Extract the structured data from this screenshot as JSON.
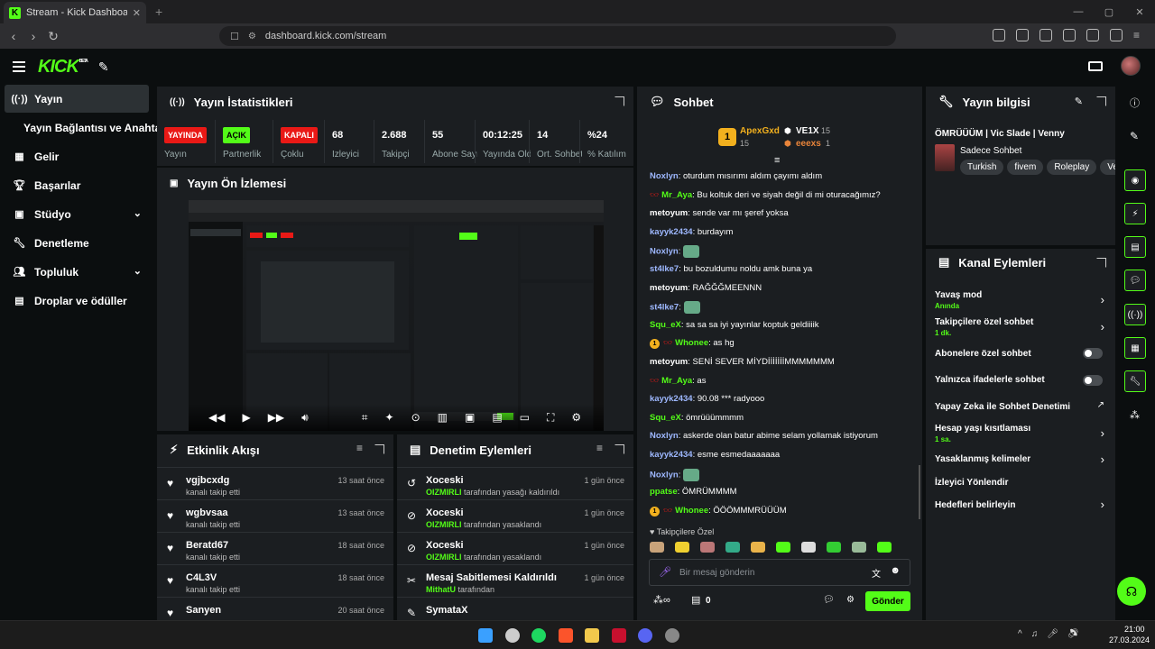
{
  "browser": {
    "tab_title": "Stream - Kick Dashboard",
    "url": "dashboard.kick.com/stream"
  },
  "header": {
    "logo": "KICK",
    "logo_badge": "BETA"
  },
  "sidebar": {
    "items": [
      {
        "label": "Yayın",
        "icon": "broadcast-icon"
      },
      {
        "label": "Yayın Bağlantısı ve Anahtarı",
        "icon": ""
      },
      {
        "label": "Gelir",
        "icon": "dollar-icon"
      },
      {
        "label": "Başarılar",
        "icon": "trophy-icon"
      },
      {
        "label": "Stüdyo",
        "icon": "studio-icon"
      },
      {
        "label": "Denetleme",
        "icon": "wrench-icon"
      },
      {
        "label": "Topluluk",
        "icon": "community-icon"
      },
      {
        "label": "Droplar ve ödüller",
        "icon": "gift-icon"
      }
    ]
  },
  "stats": {
    "title": "Yayın İstatistikleri",
    "cells": [
      {
        "badge": "YAYINDA",
        "label": "Yayın",
        "color": "#e91916"
      },
      {
        "badge": "AÇIK",
        "label": "Partnerlik",
        "color": "#53fc18"
      },
      {
        "badge": "KAPALI",
        "label": "Çoklu",
        "color": "#e91916"
      },
      {
        "value": "68",
        "label": "İzleyici"
      },
      {
        "value": "2.688",
        "label": "Takipçi"
      },
      {
        "value": "55",
        "label": "Abone Sayısı"
      },
      {
        "value": "00:12:25",
        "label": "Yayında Olduğu Süre"
      },
      {
        "value": "14",
        "label": "Ort. Sohbet"
      },
      {
        "value": "%24",
        "label": "% Katılım"
      }
    ]
  },
  "preview": {
    "title": "Yayın Ön İzlemesi"
  },
  "activity": {
    "title": "Etkinlik Akışı",
    "rows": [
      {
        "name": "vgjbcxdg",
        "sub": "kanalı takip etti",
        "time": "13 saat önce"
      },
      {
        "name": "wgbvsaa",
        "sub": "kanalı takip etti",
        "time": "13 saat önce"
      },
      {
        "name": "Beratd67",
        "sub": "kanalı takip etti",
        "time": "18 saat önce"
      },
      {
        "name": "C4L3V",
        "sub": "kanalı takip etti",
        "time": "18 saat önce"
      },
      {
        "name": "Sanyen",
        "sub": "",
        "time": "20 saat önce"
      }
    ]
  },
  "moderation": {
    "title": "Denetim Eylemleri",
    "rows": [
      {
        "name": "Xoceski",
        "by": "OIZMIRLI",
        "sub": "tarafından yasağı kaldırıldı",
        "time": "1 gün önce",
        "icon": "undo-icon"
      },
      {
        "name": "Xoceski",
        "by": "OIZMIRLI",
        "sub": "tarafından yasaklandı",
        "time": "1 gün önce",
        "icon": "ban-icon"
      },
      {
        "name": "Xoceski",
        "by": "OIZMIRLI",
        "sub": "tarafından yasaklandı",
        "time": "1 gün önce",
        "icon": "ban-icon"
      },
      {
        "name": "Mesaj Sabitlemesi Kaldırıldı",
        "by": "MithatU",
        "sub": "tarafından",
        "time": "1 gün önce",
        "icon": "unpin-icon"
      },
      {
        "name": "SymataX",
        "by": "",
        "sub": "",
        "time": "",
        "icon": "pin-icon"
      }
    ]
  },
  "chat": {
    "title": "Sohbet",
    "top": [
      {
        "rank": "1",
        "name": "ApexGxd",
        "count": "15"
      },
      {
        "name": "VE1X",
        "count": "15"
      },
      {
        "name": "eeexs",
        "count": "1"
      }
    ],
    "messages": [
      {
        "user": "Noxlyn",
        "text": "oturdum mısırımı aldım çayımı aldım",
        "color": "#9eb8ff"
      },
      {
        "user": "Mr_Aya",
        "text": "Bu koltuk deri ve siyah değil di mi oturacağımız?",
        "color": "#53fc18"
      },
      {
        "user": "metoyum",
        "text": "sende var mı şeref yoksa",
        "color": "#ffffff"
      },
      {
        "user": "kayyk2434",
        "text": "burdayım",
        "color": "#9eb8ff"
      },
      {
        "user": "Noxlyn",
        "text": "",
        "color": "#9eb8ff"
      },
      {
        "user": "st4lke7",
        "text": "bu bozuldumu noldu amk buna ya",
        "color": "#9eb8ff"
      },
      {
        "user": "metoyum",
        "text": "RAĞĞĞMEENNN",
        "color": "#ffffff"
      },
      {
        "user": "st4lke7",
        "text": "",
        "color": "#9eb8ff"
      },
      {
        "user": "Squ_eX",
        "text": "sa sa sa iyi yayınlar koptuk geldiiiik",
        "color": "#53fc18"
      },
      {
        "user": "Whonee",
        "text": "as hg",
        "color": "#53fc18"
      },
      {
        "user": "metoyum",
        "text": "SENİ SEVER MİYDİİİİİİİMMMMMMM",
        "color": "#ffffff"
      },
      {
        "user": "Mr_Aya",
        "text": "as",
        "color": "#53fc18"
      },
      {
        "user": "kayyk2434",
        "text": "90.08 *** radyooo",
        "color": "#9eb8ff"
      },
      {
        "user": "Squ_eX",
        "text": "ömrüüümmmm",
        "color": "#53fc18"
      },
      {
        "user": "Noxlyn",
        "text": "askerde olan batur abime selam yollamak istiyorum",
        "color": "#9eb8ff"
      },
      {
        "user": "kayyk2434",
        "text": "esme esmedaaaaaaa",
        "color": "#9eb8ff"
      },
      {
        "user": "Noxlyn",
        "text": "",
        "color": "#9eb8ff"
      },
      {
        "user": "ppatse",
        "text": "ÖMRÜMMMM",
        "color": "#53fc18"
      },
      {
        "user": "Whonee",
        "text": "ÖÖÖMMMRÜÜÜM",
        "color": "#53fc18"
      }
    ],
    "followers_only": "Takipçilere Özel",
    "placeholder": "Bir mesaj gönderin",
    "points": "0",
    "send": "Gönder"
  },
  "stream_info": {
    "title": "Yayın bilgisi",
    "stream_title": "ÖMRÜÜÜM | Vic Slade | Venny",
    "category": "Sadece Sohbet",
    "tags": [
      "Turkish",
      "fivem",
      "Roleplay",
      "Ver"
    ]
  },
  "channel_actions": {
    "title": "Kanal Eylemleri",
    "items": [
      {
        "label": "Yavaş mod",
        "sub": "Anında",
        "type": "chevron"
      },
      {
        "label": "Takipçilere özel sohbet",
        "sub": "1 dk.",
        "type": "chevron"
      },
      {
        "label": "Abonelere özel sohbet",
        "sub": "",
        "type": "switch"
      },
      {
        "label": "Yalnızca ifadelerle sohbet",
        "sub": "",
        "type": "switch"
      },
      {
        "label": "Yapay Zeka ile Sohbet Denetimi",
        "sub": "",
        "type": "link"
      },
      {
        "label": "Hesap yaşı kısıtlaması",
        "sub": "1 sa.",
        "type": "chevron"
      },
      {
        "label": "Yasaklanmış kelimeler",
        "sub": "",
        "type": "chevron"
      },
      {
        "label": "İzleyici Yönlendir",
        "sub": "",
        "type": "none"
      },
      {
        "label": "Hedefleri belirleyin",
        "sub": "",
        "type": "chevron"
      }
    ]
  },
  "taskbar": {
    "time": "21:00",
    "date": "27.03.2024"
  },
  "colors": {
    "accent": "#53fc18",
    "panel": "#1b1e21",
    "bg": "#0b0e0f",
    "live": "#e91916"
  }
}
